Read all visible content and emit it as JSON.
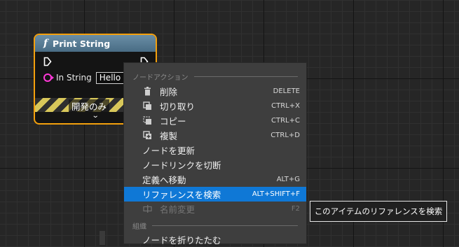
{
  "node": {
    "title": "Print String",
    "func_symbol": "f",
    "pin_label": "In String",
    "pin_value": "Hello",
    "dev_label": "開発のみ",
    "chevron": "⌄"
  },
  "menu": {
    "section_node_actions": "ノードアクション",
    "items": [
      {
        "label": "削除",
        "shortcut": "DELETE",
        "icon": "trash-icon"
      },
      {
        "label": "切り取り",
        "shortcut": "CTRL+X",
        "icon": "cut-icon"
      },
      {
        "label": "コピー",
        "shortcut": "CTRL+C",
        "icon": "copy-icon"
      },
      {
        "label": "複製",
        "shortcut": "CTRL+D",
        "icon": "duplicate-icon"
      },
      {
        "label": "ノードを更新",
        "shortcut": ""
      },
      {
        "label": "ノードリンクを切断",
        "shortcut": ""
      },
      {
        "label": "定義へ移動",
        "shortcut": "ALT+G"
      },
      {
        "label": "リファレンスを検索",
        "shortcut": "ALT+SHIFT+F"
      },
      {
        "label": "名前変更",
        "shortcut": "F2",
        "icon": "rename-icon"
      }
    ],
    "section_organize": "組織",
    "partial_item": "ノードを折りたたむ"
  },
  "tooltip": "このアイテムのリファレンスを検索",
  "colors": {
    "node_border": "#f4a00c",
    "node_header": "#5a7d95",
    "string_pin": "#ff38d8",
    "selection": "#0f78d6"
  }
}
